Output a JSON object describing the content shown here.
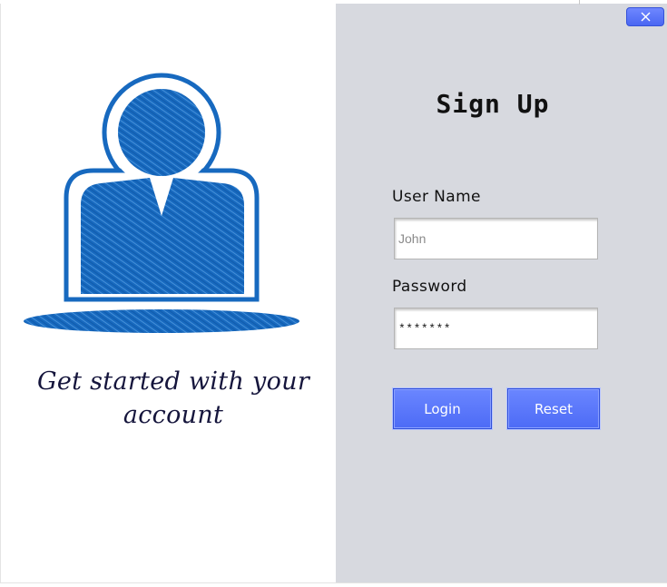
{
  "left_panel": {
    "tagline_line1": "Get started with your",
    "tagline_line2": "account",
    "avatar_icon": "user-silhouette-icon",
    "accent_color": "#1769bf"
  },
  "window": {
    "close_icon": "close-icon"
  },
  "form": {
    "title": "Sign Up",
    "username_label": "User Name",
    "username_placeholder": "John",
    "password_label": "Password",
    "password_value": "*******",
    "login_label": "Login",
    "reset_label": "Reset",
    "button_color": "#5070f8",
    "panel_color": "#d7d9df"
  }
}
